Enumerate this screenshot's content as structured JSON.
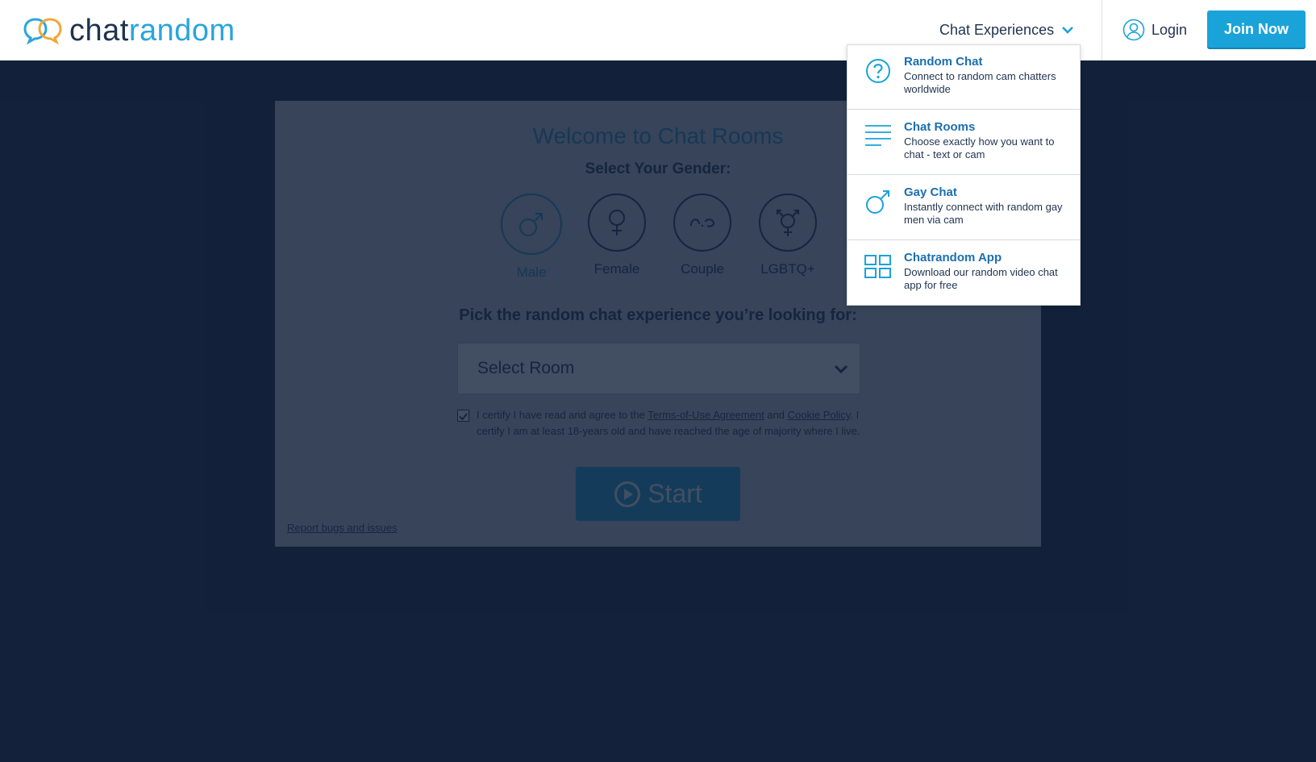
{
  "header": {
    "logo_part1": "chat",
    "logo_part2": "random",
    "nav_experiences": "Chat Experiences",
    "login": "Login",
    "join": "Join Now"
  },
  "main": {
    "welcome": "Welcome to Chat Rooms",
    "select_gender": "Select Your Gender:",
    "genders": [
      {
        "label": "Male",
        "icon": "male-icon",
        "active": true
      },
      {
        "label": "Female",
        "icon": "female-icon",
        "active": false
      },
      {
        "label": "Couple",
        "icon": "couple-icon",
        "active": false
      },
      {
        "label": "LGBTQ+",
        "icon": "lgbtq-icon",
        "active": false
      }
    ],
    "pick_text": "Pick the random chat experience you’re looking for:",
    "select_room_placeholder": "Select Room",
    "certify_pre": "I certify I have read and agree to the ",
    "terms_link": "Terms-of-Use Agreement",
    "certify_and": " and ",
    "cookie_link": "Cookie Policy",
    "certify_post": ". I certify I am at least 18-years old and have reached the age of majority where I live.",
    "certify_checked": true,
    "start_label": "Start",
    "report_link": "Report bugs and issues"
  },
  "dropdown": {
    "items": [
      {
        "title": "Random Chat",
        "desc": "Connect to random cam chatters worldwide",
        "icon": "question-icon"
      },
      {
        "title": "Chat Rooms",
        "desc": "Choose exactly how you want to chat - text or cam",
        "icon": "lines-icon"
      },
      {
        "title": "Gay Chat",
        "desc": "Instantly connect with random gay men via cam",
        "icon": "male-icon"
      },
      {
        "title": "Chatrandom App",
        "desc": "Download our random video chat app for free",
        "icon": "grid-icon"
      }
    ]
  },
  "colors": {
    "accent": "#1aa3d9",
    "navy": "#1e3350",
    "backdrop": "#13223a"
  }
}
